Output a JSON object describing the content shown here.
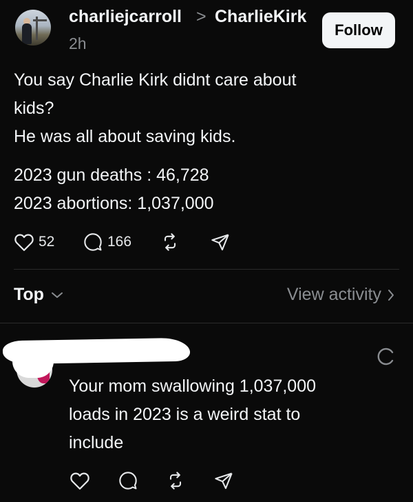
{
  "post": {
    "author": "charliejcarroll",
    "separator": ">",
    "community": "CharlieKirk",
    "time": "2h",
    "follow_label": "Follow",
    "lines": [
      "You say Charlie Kirk didnt care about",
      "kids?",
      "He was all about saving kids.",
      "2023 gun deaths : 46,728",
      "2023 abortions: 1,037,000"
    ],
    "likes": "52",
    "comments": "166"
  },
  "replies_header": {
    "sort_label": "Top",
    "view_activity": "View activity"
  },
  "reply": {
    "lines": [
      "Your mom swallowing 1,037,000",
      "loads in 2023 is a weird stat to",
      "include"
    ]
  },
  "colors": {
    "background": "#0a0a0a",
    "text": "#f3f5f7",
    "muted": "#8a8d91",
    "follow_bg": "#f3f5f7"
  }
}
